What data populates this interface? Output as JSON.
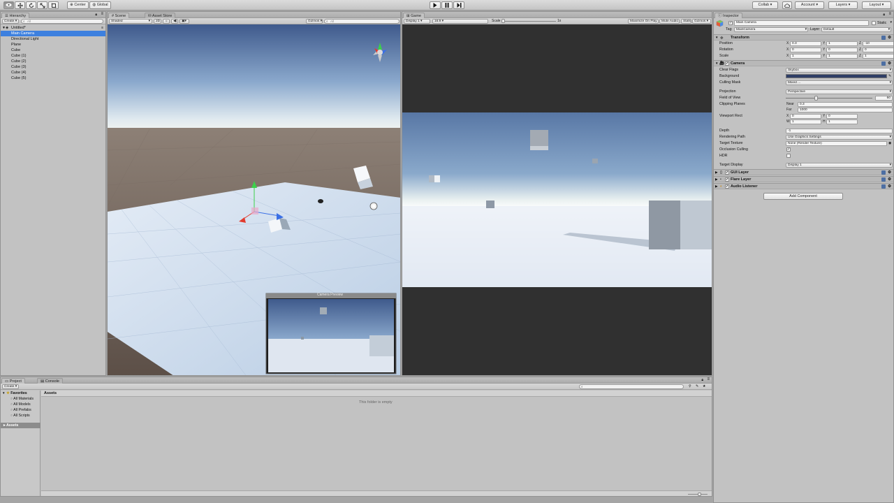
{
  "toolbar": {
    "pivot_label": "Center",
    "space_label": "Global",
    "collab_label": "Collab ▾",
    "account_label": "Account",
    "layers_label": "Layers",
    "layout_label": "Layout"
  },
  "hierarchy": {
    "tab_label": "Hierarchy",
    "create_label": "Create ▾",
    "search_placeholder": "All",
    "scene_name": "Untitled*",
    "items": [
      {
        "label": "Main Camera",
        "selected": true
      },
      {
        "label": "Directional Light",
        "selected": false
      },
      {
        "label": "Plane",
        "selected": false
      },
      {
        "label": "Cube",
        "selected": false
      },
      {
        "label": "Cube (1)",
        "selected": false
      },
      {
        "label": "Cube (2)",
        "selected": false
      },
      {
        "label": "Cube (3)",
        "selected": false
      },
      {
        "label": "Cube (4)",
        "selected": false
      },
      {
        "label": "Cube (5)",
        "selected": false
      }
    ]
  },
  "scene": {
    "tab_label": "Scene",
    "asset_store_tab": "Asset Store",
    "shading_mode": "Shaded",
    "mode_2d": "2D",
    "gizmos_label": "Gizmos ▾",
    "search_placeholder": "All",
    "camera_preview_title": "Camera Preview"
  },
  "game": {
    "tab_label": "Game",
    "display": "Display 1 ▾",
    "aspect": "16:9 ▾",
    "scale_label": "Scale",
    "scale_value": "1x",
    "maximize_label": "Maximize On Play",
    "mute_label": "Mute Audio",
    "stats_label": "Stats",
    "gizmos_label": "Gizmos ▾"
  },
  "inspector": {
    "tab_label": "Inspector",
    "object_name": "Main Camera",
    "static_label": "Static",
    "tag_label": "Tag",
    "tag_value": "MainCamera",
    "layer_label": "Layer",
    "layer_value": "Default",
    "transform": {
      "title": "Transform",
      "position_label": "Position",
      "rotation_label": "Rotation",
      "scale_label": "Scale",
      "position": {
        "x": "0.3",
        "y": "1",
        "z": "-10"
      },
      "rotation": {
        "x": "0",
        "y": "0",
        "z": "0"
      },
      "scale": {
        "x": "1",
        "y": "1",
        "z": "1"
      }
    },
    "camera": {
      "title": "Camera",
      "clear_flags_label": "Clear Flags",
      "clear_flags_value": "Skybox",
      "background_label": "Background",
      "background_color": "#2f3e66",
      "culling_mask_label": "Culling Mask",
      "culling_mask_value": "Mixed ...",
      "projection_label": "Projection",
      "projection_value": "Perspective",
      "fov_label": "Field of View",
      "fov_value": "60",
      "fov_fraction": 0.33,
      "clipping_label": "Clipping Planes",
      "near_label": "Near",
      "near_value": "0.3",
      "far_label": "Far",
      "far_value": "1000",
      "viewport_label": "Viewport Rect",
      "vp_x": "0",
      "vp_y": "0",
      "vp_w": "1",
      "vp_h": "1",
      "depth_label": "Depth",
      "depth_value": "-1",
      "rendering_path_label": "Rendering Path",
      "rendering_path_value": "Use Graphics Settings",
      "target_texture_label": "Target Texture",
      "target_texture_value": "None (Render Texture)",
      "occlusion_label": "Occlusion Culling",
      "hdr_label": "HDR",
      "target_display_label": "Target Display",
      "target_display_value": "Display 1"
    },
    "components": [
      {
        "label": "GUI Layer"
      },
      {
        "label": "Flare Layer"
      },
      {
        "label": "Audio Listener"
      }
    ],
    "add_component_label": "Add Component"
  },
  "project": {
    "tab_label": "Project",
    "console_tab": "Console",
    "create_label": "Create ▾",
    "favorites_label": "Favorites",
    "favorites": [
      "All Materials",
      "All Models",
      "All Prefabs",
      "All Scripts"
    ],
    "assets_label": "Assets",
    "breadcrumb": "Assets",
    "empty_message": "This folder is empty"
  }
}
